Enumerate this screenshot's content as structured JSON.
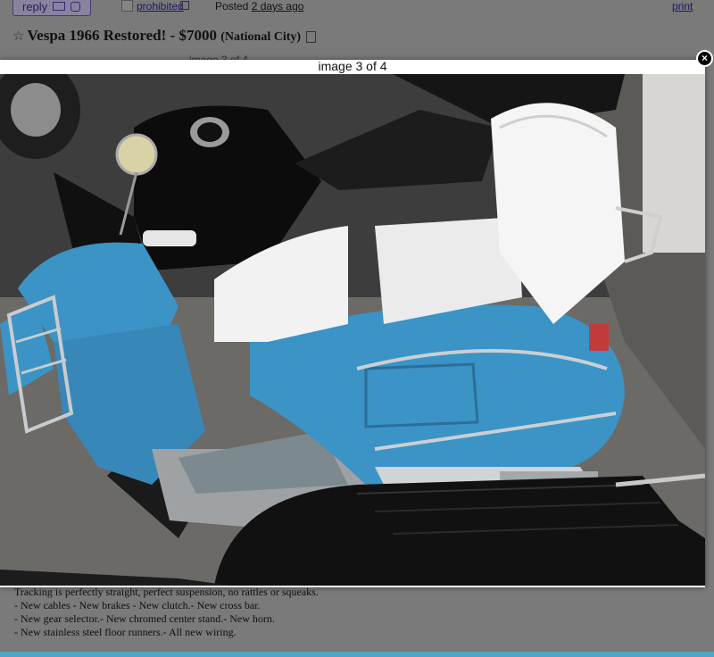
{
  "topbar": {
    "reply_label": "reply",
    "prohibited_label": "prohibited",
    "posted_prefix": "Posted",
    "posted_when": "2 days ago",
    "print_label": "print"
  },
  "listing": {
    "title": "Vespa 1966 Restored! - $7000",
    "location": "(National City)"
  },
  "lightbox": {
    "counter": "image 3 of 4",
    "close_glyph": "×",
    "photo_icon": "photo-vespa-scooter"
  },
  "body_lines": [
    "Tracking is perfectly straight, perfect suspension, no rattles or squeaks.",
    "- New cables - New brakes - New clutch.- New cross bar.",
    "- New gear selector.- New chromed center stand.- New horn.",
    "- New stainless steel floor runners.- All new wiring."
  ],
  "colors": {
    "accent_bottom": "#4fa6c4",
    "scooter_blue": "#3b93c6"
  }
}
